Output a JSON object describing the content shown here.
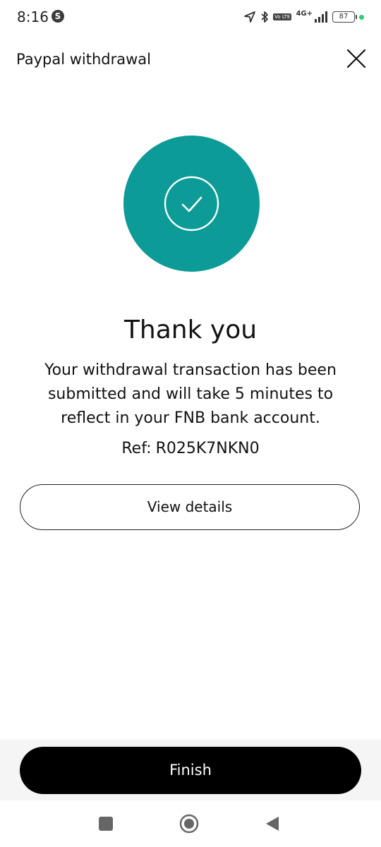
{
  "status_bar": {
    "time": "8:16",
    "app_icon_letter": "S",
    "network": "4G+",
    "volte_label": "Vo LTE",
    "battery": "87"
  },
  "header": {
    "title": "Paypal withdrawal"
  },
  "success": {
    "accent_color": "#0c9b96",
    "icon": "check-circle-icon"
  },
  "content": {
    "heading": "Thank you",
    "message": "Your withdrawal transaction has been submitted and will take 5 minutes to reflect in your FNB bank account.",
    "ref_label": "Ref:",
    "ref_value": "R025K7NKN0"
  },
  "actions": {
    "view_details_label": "View details",
    "finish_label": "Finish"
  },
  "nav_bar": {
    "recent_icon": "square-icon",
    "home_icon": "circle-icon",
    "back_icon": "triangle-back-icon"
  }
}
